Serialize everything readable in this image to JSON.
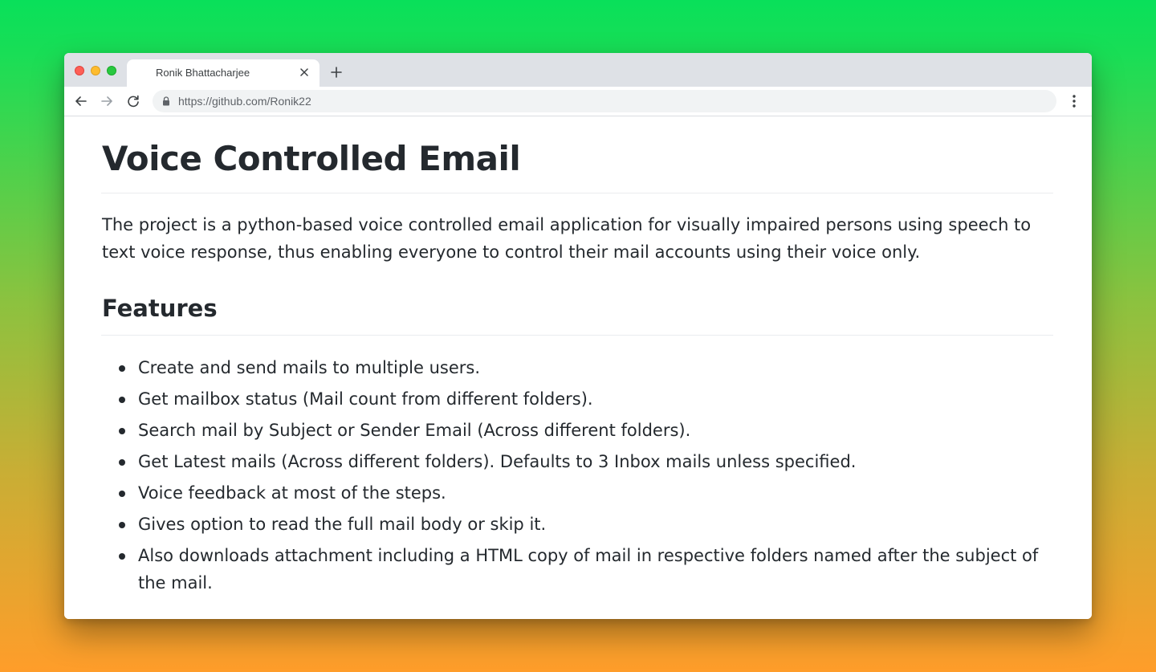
{
  "browser": {
    "tab_title": "Ronik Bhattacharjee",
    "url": "https://github.com/Ronik22",
    "icons": {
      "close_window": "traffic-close",
      "minimize_window": "traffic-minimize",
      "maximize_window": "traffic-maximize",
      "tab_close": "close-icon",
      "new_tab": "plus-icon",
      "back": "arrow-left-icon",
      "forward": "arrow-right-icon",
      "reload": "reload-icon",
      "secure": "lock-icon",
      "menu": "kebab-menu-icon"
    },
    "colors": {
      "traffic_red": "#fe5f57",
      "traffic_yellow": "#febc2e",
      "traffic_green": "#28c840",
      "chrome_bg": "#dee1e6",
      "omnibox_bg": "#f1f3f4"
    }
  },
  "readme": {
    "title": "Voice Controlled Email",
    "description": "The project is a python-based voice controlled email application for visually impaired persons using speech to text voice response, thus enabling everyone to control their mail accounts using their voice only.",
    "features_heading": "Features",
    "features": [
      "Create and send mails to multiple users.",
      "Get mailbox status (Mail count from different folders).",
      "Search mail by Subject or Sender Email (Across different folders).",
      "Get Latest mails (Across different folders). Defaults to 3 Inbox mails unless specified.",
      "Voice feedback at most of the steps.",
      "Gives option to read the full mail body or skip it.",
      "Also downloads attachment including a HTML copy of mail in respective folders named after the subject of the mail."
    ]
  },
  "background": {
    "gradient_top": "#09e05a",
    "gradient_bottom": "#ff9d2a"
  }
}
